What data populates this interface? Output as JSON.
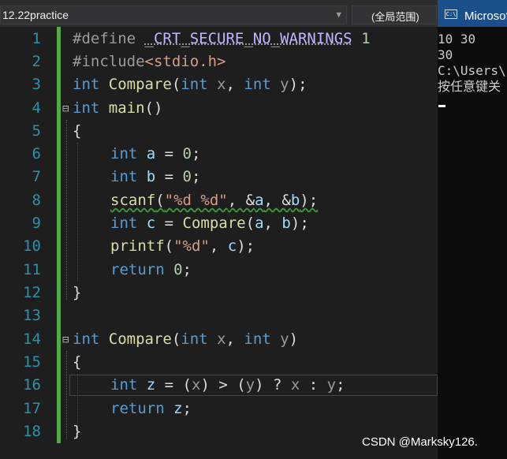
{
  "toolbar": {
    "file_label": "12.22practice",
    "scope_label": "(全局范围)"
  },
  "editor": {
    "line_numbers": [
      "1",
      "2",
      "3",
      "4",
      "5",
      "6",
      "7",
      "8",
      "9",
      "10",
      "11",
      "12",
      "13",
      "14",
      "15",
      "16",
      "17",
      "18"
    ],
    "lines": {
      "l1": {
        "pp": "#define ",
        "mac": "_CRT_SECURE_NO_WARNINGS",
        "sp": " ",
        "num": "1"
      },
      "l2": {
        "pp": "#include",
        "inc": "<stdio.h>"
      },
      "l3": {
        "kw1": "int",
        "fn": " Compare",
        "p1": "(",
        "kw2": "int",
        "pm1": " x",
        "c1": ", ",
        "kw3": "int",
        "pm2": " y",
        "p2": ");"
      },
      "l4": {
        "kw": "int",
        "fn": " main",
        "p": "()"
      },
      "l5": {
        "t": "{"
      },
      "l6": {
        "kw": "int",
        "lv": " a",
        "op": " = ",
        "num": "0",
        "end": ";"
      },
      "l7": {
        "kw": "int",
        "lv": " b",
        "op": " = ",
        "num": "0",
        "end": ";"
      },
      "l8": {
        "fn": "scanf",
        "p1": "(",
        "str": "\"%d %d\"",
        "rest1": ", &",
        "lv1": "a",
        "rest2": ", &",
        "lv2": "b",
        "end": ");"
      },
      "l9": {
        "kw": "int",
        "lv": " c",
        "op": " = ",
        "fn": "Compare",
        "p1": "(",
        "lv1": "a",
        "c": ", ",
        "lv2": "b",
        "end": ");"
      },
      "l10": {
        "fn": "printf",
        "p1": "(",
        "str": "\"%d\"",
        "c": ", ",
        "lv": "c",
        "end": ");"
      },
      "l11": {
        "kw": "return",
        "sp": " ",
        "num": "0",
        "end": ";"
      },
      "l12": {
        "t": "}"
      },
      "l14": {
        "kw1": "int",
        "fn": " Compare",
        "p1": "(",
        "kw2": "int",
        "pm1": " x",
        "c1": ", ",
        "kw3": "int",
        "pm2": " y",
        "p2": ")"
      },
      "l15": {
        "t": "{"
      },
      "l16": {
        "kw": "int",
        "lv": " z",
        "op": " = (",
        "pm1": "x",
        "op2": ") > (",
        "pm2": "y",
        "op3": ") ? ",
        "pm3": "x",
        "op4": " : ",
        "pm4": "y",
        "end": ";"
      },
      "l17": {
        "kw": "return",
        "lv": " z",
        "end": ";"
      },
      "l18": {
        "t": "}"
      }
    }
  },
  "console": {
    "title": "Microsoft Visual Studio 调试控制台",
    "icon": "console-window-icon",
    "lines": [
      "10 30",
      "30",
      "C:\\Users\\",
      "按任意键关"
    ]
  },
  "watermark": "CSDN @Marksky126.",
  "colors": {
    "keyword": "#569cd6",
    "function": "#dcdcaa",
    "string": "#d69d85",
    "local_var": "#9cdcfe",
    "number": "#b5cea8",
    "line_number": "#2b91af",
    "change_bar": "#57a64a",
    "console_title": "#1a4f8c"
  }
}
